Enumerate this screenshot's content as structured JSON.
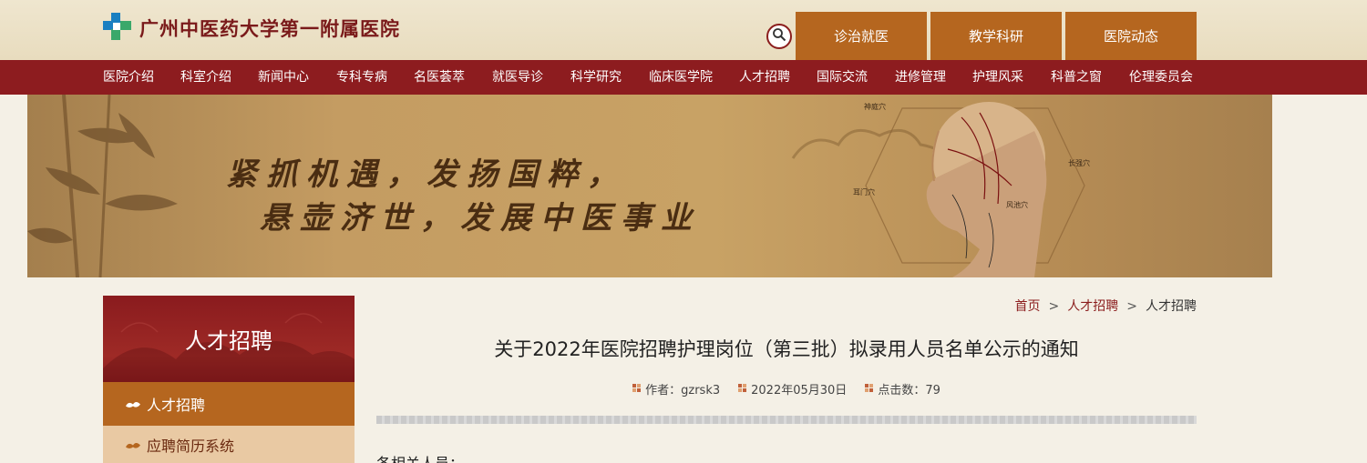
{
  "site": {
    "name": "广州中医药大学第一附属医院"
  },
  "top_tabs": [
    {
      "label": "诊治就医"
    },
    {
      "label": "教学科研"
    },
    {
      "label": "医院动态"
    }
  ],
  "nav": [
    {
      "label": "医院介绍"
    },
    {
      "label": "科室介绍"
    },
    {
      "label": "新闻中心"
    },
    {
      "label": "专科专病"
    },
    {
      "label": "名医荟萃"
    },
    {
      "label": "就医导诊"
    },
    {
      "label": "科学研究"
    },
    {
      "label": "临床医学院"
    },
    {
      "label": "人才招聘"
    },
    {
      "label": "国际交流"
    },
    {
      "label": "进修管理"
    },
    {
      "label": "护理风采"
    },
    {
      "label": "科普之窗"
    },
    {
      "label": "伦理委员会"
    }
  ],
  "banner": {
    "line1": "紧抓机遇，发扬国粹，",
    "line2": "悬壶济世，发展中医事业",
    "acupoints": [
      "神庭穴",
      "耳门穴",
      "风池穴",
      "长强穴"
    ]
  },
  "sidebar": {
    "title": "人才招聘",
    "items": [
      {
        "label": "人才招聘",
        "active": true
      },
      {
        "label": "应聘简历系统",
        "active": false
      }
    ]
  },
  "breadcrumb": {
    "home": "首页",
    "sep": ">",
    "section": "人才招聘",
    "current": "人才招聘"
  },
  "article": {
    "title": "关于2022年医院招聘护理岗位（第三批）拟录用人员名单公示的通知",
    "author": "作者：gzrsk3",
    "date": "2022年05月30日",
    "clicks": "点击数：79",
    "body_start": "各相关人员："
  },
  "colors": {
    "nav_bg": "#8d1c1f",
    "tab_bg": "#b5661f",
    "side_item_bg": "#e9c9a3"
  }
}
